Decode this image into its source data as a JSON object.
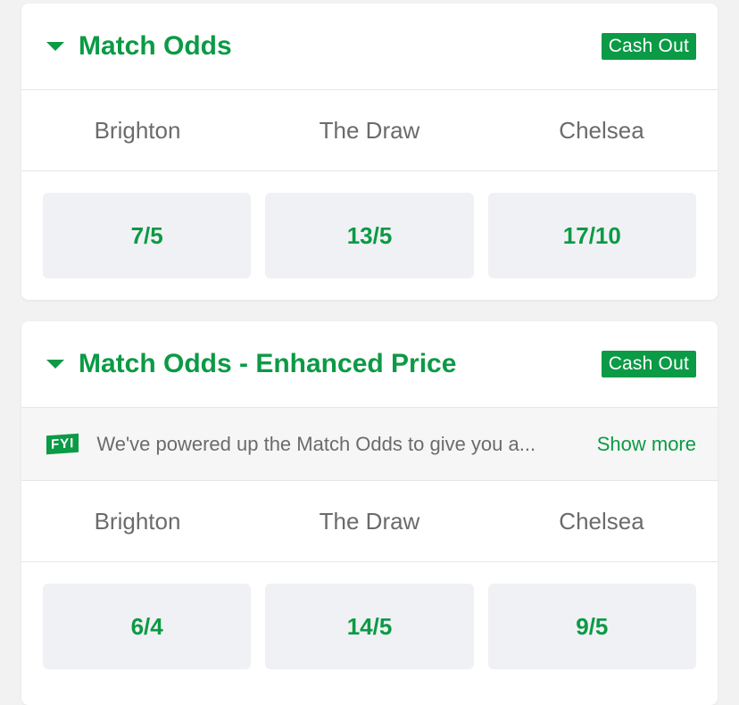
{
  "markets": [
    {
      "title": "Match Odds",
      "badge": "Cash Out",
      "selections": [
        "Brighton",
        "The Draw",
        "Chelsea"
      ],
      "odds": [
        "7/5",
        "13/5",
        "17/10"
      ]
    },
    {
      "title": "Match Odds - Enhanced Price",
      "badge": "Cash Out",
      "info": {
        "tag": "FYI",
        "text": "We've powered up the Match Odds to give you a...",
        "show_more": "Show more"
      },
      "selections": [
        "Brighton",
        "The Draw",
        "Chelsea"
      ],
      "odds": [
        "6/4",
        "14/5",
        "9/5"
      ]
    }
  ],
  "colors": {
    "accent": "#0b9a45",
    "muted_text": "#6b6b6b",
    "odds_bg": "#f0f1f4"
  }
}
